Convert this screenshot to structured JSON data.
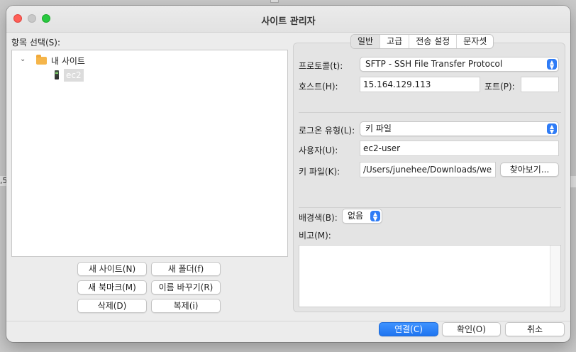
{
  "window": {
    "title": "사이트 관리자"
  },
  "left": {
    "select_entry_label": "항목 선택(S):",
    "tree": {
      "root": "내 사이트",
      "child": "ec2"
    },
    "buttons": {
      "new_site": "새 사이트(N)",
      "new_folder": "새 폴더(f)",
      "new_bookmark": "새 북마크(M)",
      "rename": "이름 바꾸기(R)",
      "delete": "삭제(D)",
      "duplicate": "복제(i)"
    }
  },
  "tabs": [
    "일반",
    "고급",
    "전송 설정",
    "문자셋"
  ],
  "general": {
    "protocol_label": "프로토콜(t):",
    "protocol_value": "SFTP - SSH File Transfer Protocol",
    "host_label": "호스트(H):",
    "host_value": "15.164.129.113",
    "port_label": "포트(P):",
    "port_value": "",
    "logon_type_label": "로그온 유형(L):",
    "logon_type_value": "키 파일",
    "user_label": "사용자(U):",
    "user_value": "ec2-user",
    "keyfile_label": "키 파일(K):",
    "keyfile_value": "/Users/junehee/Downloads/we",
    "browse_button": "찾아보기...",
    "bg_color_label": "배경색(B):",
    "bg_color_value": "없음",
    "comments_label": "비고(M):"
  },
  "footer": {
    "connect": "연결(C)",
    "ok": "확인(O)",
    "cancel": "취소"
  },
  "background": {
    "fragment": ",5"
  },
  "colors": {
    "accent": "#1f75f0",
    "folder": "#f5b54a"
  }
}
